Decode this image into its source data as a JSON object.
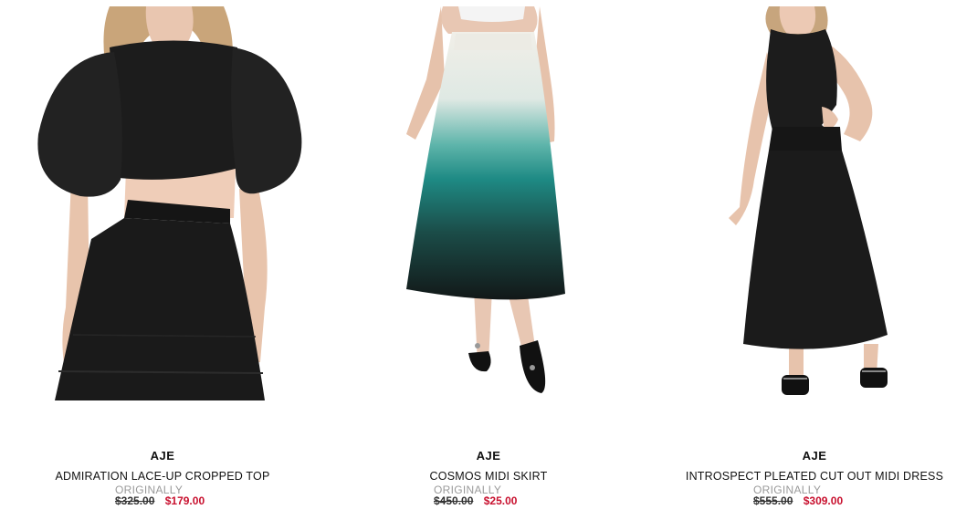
{
  "products": [
    {
      "brand": "AJE",
      "title": "ADMIRATION LACE-UP CROPPED TOP",
      "originally_label": "ORIGINALLY",
      "original_price": "$325.00",
      "sale_price": "$179.00",
      "image": "model-black-cropped-top-and-skirt"
    },
    {
      "brand": "AJE",
      "title": "COSMOS MIDI SKIRT",
      "originally_label": "ORIGINALLY",
      "original_price": "$450.00",
      "sale_price": "$25.00",
      "image": "model-ombre-teal-midi-skirt"
    },
    {
      "brand": "AJE",
      "title": "INTROSPECT PLEATED CUT OUT MIDI DRESS",
      "originally_label": "ORIGINALLY",
      "original_price": "$555.00",
      "sale_price": "$309.00",
      "image": "model-black-cutout-midi-dress"
    }
  ],
  "colors": {
    "sale": "#c8102e",
    "muted": "#9a9a9a",
    "garment_black": "#1c1c1c",
    "ombre_teal": "#1e8a84"
  }
}
